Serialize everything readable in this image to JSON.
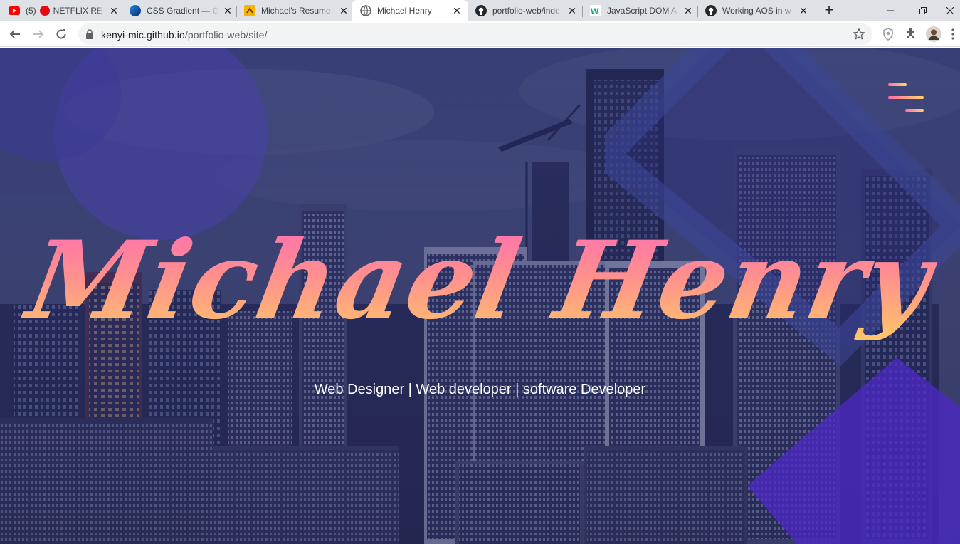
{
  "browser": {
    "tabs": [
      {
        "label": "(5)",
        "label2": "NETFLIX RE",
        "favicon": "youtube-icon",
        "active": false
      },
      {
        "label": "CSS Gradient — G",
        "favicon": "css-gradient-icon",
        "active": false
      },
      {
        "label": "Michael's Resume",
        "favicon": "resume-icon",
        "active": false
      },
      {
        "label": "Michael Henry",
        "favicon": "globe-icon",
        "active": true
      },
      {
        "label": "portfolio-web/inde",
        "favicon": "github-icon",
        "active": false
      },
      {
        "label": "JavaScript DOM A",
        "favicon": "w3schools-icon",
        "active": false
      },
      {
        "label": "Working AOS in w",
        "favicon": "github-icon",
        "active": false
      }
    ],
    "url_domain": "kenyi-mic.github.io",
    "url_path": "/portfolio-web/site/"
  },
  "hero": {
    "name": "Michael Henry",
    "subtitle": "Web Designer | Web developer | software Developer"
  },
  "colors": {
    "gradient_start": "#ff6fb0",
    "gradient_end": "#ffc66a",
    "overlay": "#282c6e",
    "accent_purple": "#4a2fc8"
  }
}
